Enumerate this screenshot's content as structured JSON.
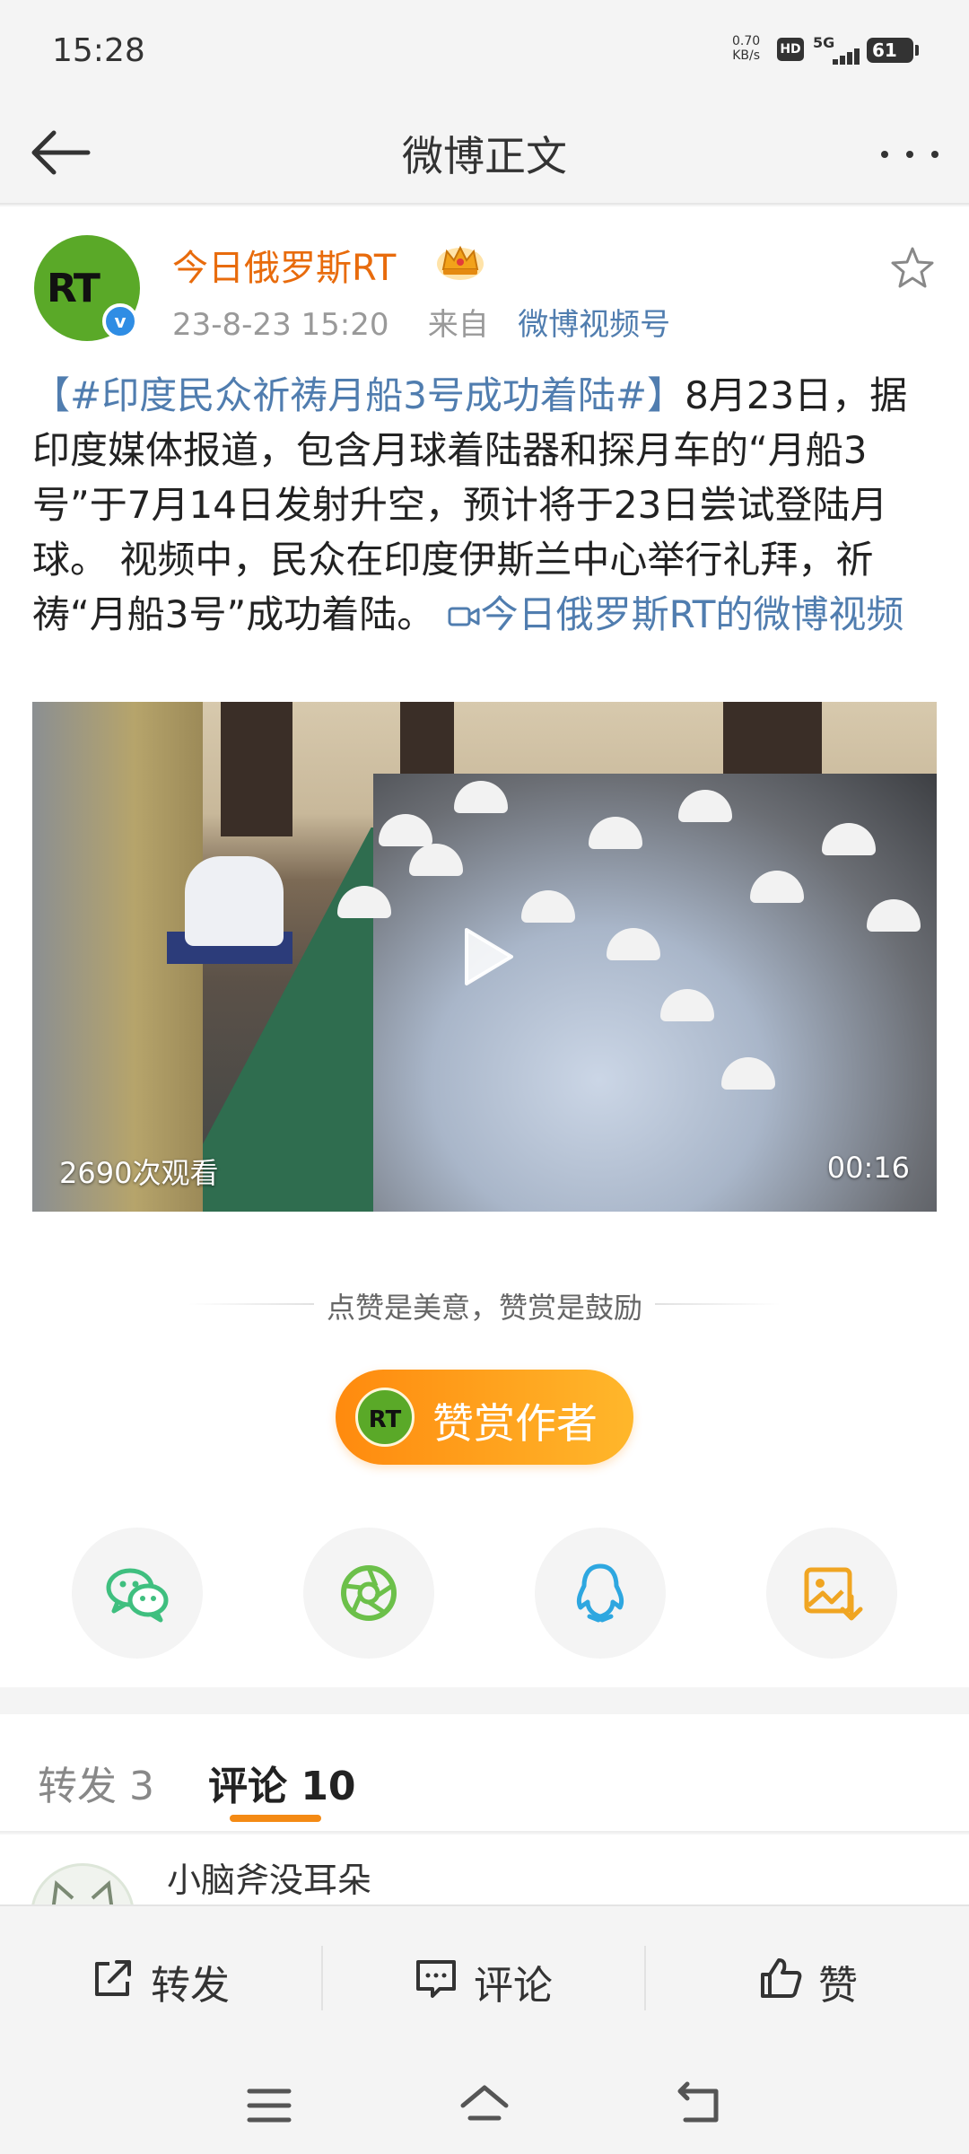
{
  "status_bar": {
    "time": "15:28",
    "net_speed_value": "0.70",
    "net_speed_unit": "KB/s",
    "hd": "HD",
    "network": "5G",
    "battery": "61"
  },
  "nav": {
    "title": "微博正文",
    "back_icon": "back-arrow-icon",
    "more_icon": "more-dots-icon"
  },
  "post": {
    "author": "今日俄罗斯RT",
    "avatar_text": "RT",
    "verified_mark": "v",
    "date": "23-8-23 15:20",
    "source_prefix": "来自",
    "source": "微博视频号",
    "hashtag": "【#印度民众祈祷月船3号成功着陆#】",
    "body": "8月23日，据印度媒体报道，包含月球着陆器和探月车的“月船3号”于7月14日发射升空，预计将于23日尝试登陆月球。 视频中，民众在印度伊斯兰中心举行礼拜，祈祷“月船3号”成功着陆。",
    "video_link": "今日俄罗斯RT的微博视频"
  },
  "video": {
    "views": "2690次观看",
    "duration": "00:16"
  },
  "reward": {
    "tip": "点赞是美意，赞赏是鼓励",
    "button_icon_text": "RT",
    "button_label": "赞赏作者"
  },
  "share": {
    "icons": [
      "wechat-icon",
      "moments-icon",
      "qq-icon",
      "save-image-icon"
    ]
  },
  "tabs": {
    "repost": "转发 3",
    "comments": "评论 10"
  },
  "comment_preview": {
    "name": "小脑斧没耳朵"
  },
  "actions": {
    "repost": "转发",
    "comment": "评论",
    "like": "赞"
  },
  "colors": {
    "accent_orange": "#f48a14",
    "link_blue": "#507daf",
    "author_orange": "#e86b0c"
  }
}
